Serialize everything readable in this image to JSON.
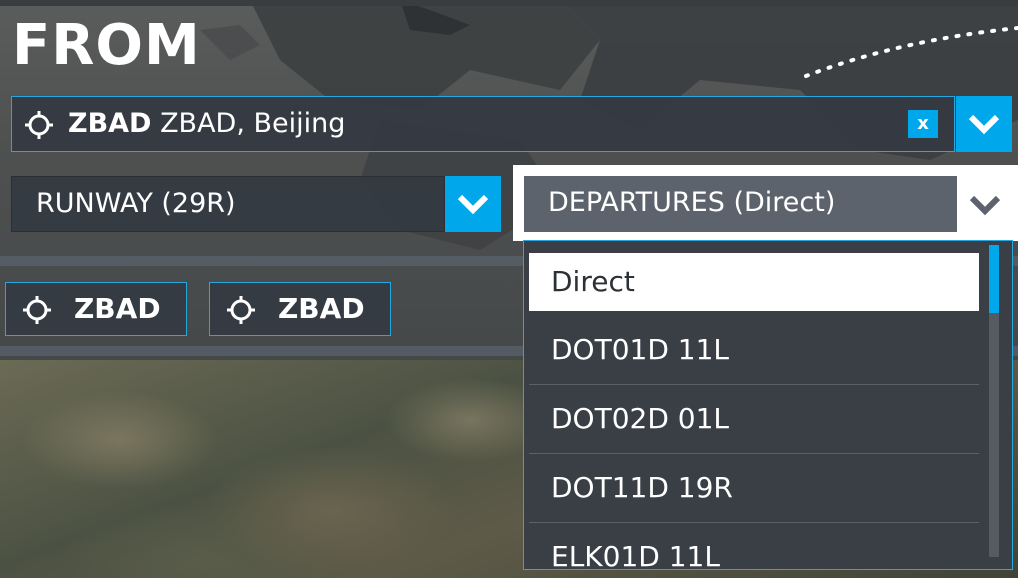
{
  "from_panel": {
    "title": "FROM",
    "airport": {
      "code": "ZBAD",
      "name": "ZBAD, Beijing",
      "clear_label": "x",
      "icon": "target-icon"
    },
    "runway": {
      "label": "RUNWAY (29R)"
    },
    "departures": {
      "label": "DEPARTURES (Direct)",
      "options": [
        "Direct",
        "DOT01D 11L",
        "DOT02D 01L",
        "DOT11D 19R",
        "ELK01D 11L"
      ],
      "selected": "Direct"
    },
    "chips": [
      {
        "label": "ZBAD",
        "icon": "target-icon"
      },
      {
        "label": "ZBAD",
        "icon": "target-icon"
      }
    ]
  },
  "colors": {
    "accent": "#00a7ea",
    "panel": "#343a42",
    "selected_bg": "#ffffff"
  }
}
